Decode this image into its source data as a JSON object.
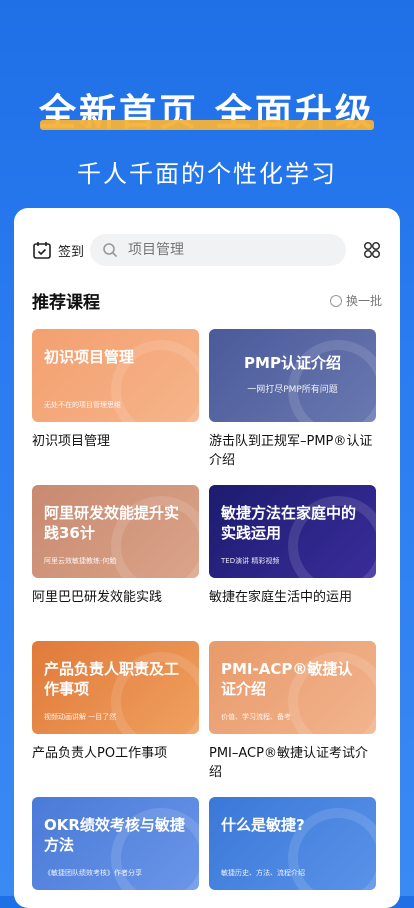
{
  "hero": {
    "title": "全新首页 全面升级",
    "subtitle": "千人千面的个性化学习"
  },
  "toolbar": {
    "signin_label": "签到",
    "search_placeholder": "项目管理"
  },
  "section": {
    "title": "推荐课程",
    "refresh_label": "换一批"
  },
  "colors": {
    "brand_blue": "#2176eb",
    "accent_yellow": "#f6b23a"
  },
  "courses": [
    {
      "thumb_title": "初识项目管理",
      "thumb_sub": "无处不在的项目管理思维",
      "name": "初识项目管理",
      "color_from": "#f3a070",
      "color_to": "#f6b48a"
    },
    {
      "thumb_title": "PMP认证介绍",
      "thumb_sub": "一网打尽PMP所有问题",
      "name": "游击队到正规军–PMP®认证介绍",
      "color_from": "#4a5a9a",
      "color_to": "#6a78b0"
    },
    {
      "thumb_title": "阿里研发效能提升实践36计",
      "thumb_sub": "阿里云效敏捷教练·何勉",
      "name": "阿里巴巴研发效能实践",
      "color_from": "#c88a70",
      "color_to": "#dba48a"
    },
    {
      "thumb_title": "敏捷方法在家庭中的实践运用",
      "thumb_sub": "TED演讲 精彩视频",
      "name": "敏捷在家庭生活中的运用",
      "color_from": "#1c1c6e",
      "color_to": "#3a2c9a"
    },
    {
      "thumb_title": "产品负责人职责及工作事项",
      "thumb_sub": "视频动画讲解 一目了然",
      "name": "产品负责人PO工作事项",
      "color_from": "#e07a3a",
      "color_to": "#f0a060"
    },
    {
      "thumb_title": "PMI-ACP®敏捷认证介绍",
      "thumb_sub": "价值、学习流程、备考",
      "name": "PMI–ACP®敏捷认证考试介绍",
      "color_from": "#e89a6a",
      "color_to": "#f2b48e"
    },
    {
      "thumb_title": "OKR绩效考核与敏捷方法",
      "thumb_sub": "《敏捷团队绩效考核》作者分享",
      "name": "",
      "color_from": "#4a7ad8",
      "color_to": "#6a96e8"
    },
    {
      "thumb_title": "什么是敏捷?",
      "thumb_sub": "敏捷历史、方法、流程介绍",
      "name": "",
      "color_from": "#3a78d8",
      "color_to": "#5a92e8"
    }
  ]
}
